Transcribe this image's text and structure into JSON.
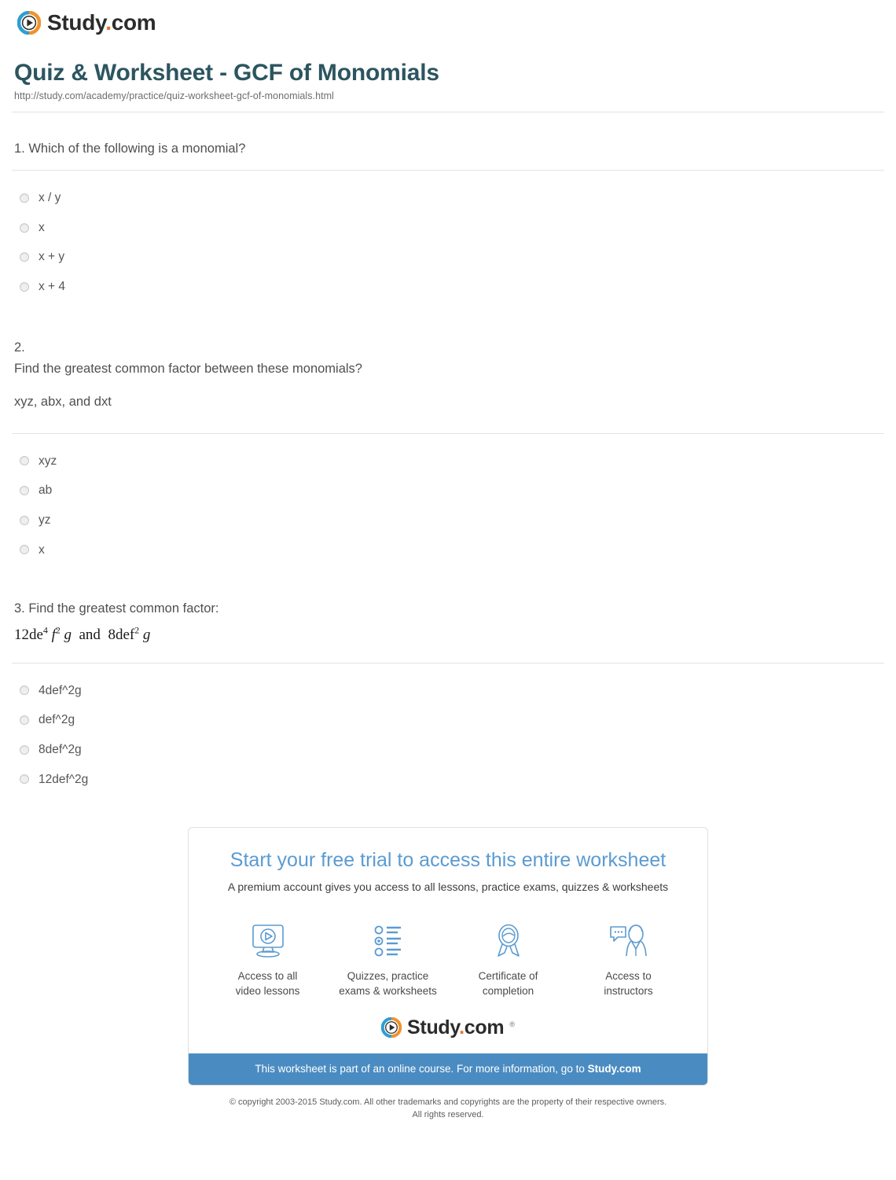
{
  "header": {
    "logo_word_main": "Study",
    "logo_word_dot": ".",
    "logo_word_tld": "com",
    "logo_icon": "play-circle-icon"
  },
  "title": {
    "heading": "Quiz & Worksheet - GCF of Monomials",
    "url": "http://study.com/academy/practice/quiz-worksheet-gcf-of-monomials.html"
  },
  "questions": [
    {
      "prompt": "1. Which of the following is a monomial?",
      "prompt2": "",
      "prompt3": "",
      "math": "",
      "options": [
        {
          "label": "x / y"
        },
        {
          "label": "x"
        },
        {
          "label": "x + y"
        },
        {
          "label": "x + 4"
        }
      ]
    },
    {
      "prompt": "2.",
      "prompt2": "Find the greatest common factor between these monomials?",
      "prompt3": "xyz, abx, and dxt",
      "math": "",
      "options": [
        {
          "label": "xyz"
        },
        {
          "label": "ab"
        },
        {
          "label": "yz"
        },
        {
          "label": "x"
        }
      ]
    },
    {
      "prompt": "3. Find the greatest common factor:",
      "prompt2": "",
      "prompt3": "",
      "math": "12de4 f2 g  and  8def2 g",
      "math_parts": {
        "coef1": "12de",
        "exp1": "4",
        "var_f": "f",
        "exp_f": "2",
        "var_g": "g",
        "conjunction": "and",
        "coef2": "8def",
        "exp2": "2",
        "var_g2": "g"
      },
      "options": [
        {
          "label": "4def^2g"
        },
        {
          "label": "def^2g"
        },
        {
          "label": "8def^2g"
        },
        {
          "label": "12def^2g"
        }
      ]
    }
  ],
  "promo": {
    "headline": "Start your free trial to access this entire worksheet",
    "subtitle": "A premium account gives you access to all lessons, practice exams, quizzes & worksheets",
    "features": [
      {
        "icon": "monitor-play-icon",
        "label": "Access to all\nvideo lessons"
      },
      {
        "icon": "checklist-icon",
        "label": "Quizzes, practice\nexams & worksheets"
      },
      {
        "icon": "award-ribbon-icon",
        "label": "Certificate of\ncompletion"
      },
      {
        "icon": "instructor-chat-icon",
        "label": "Access to\ninstructors"
      }
    ],
    "logo_word_main": "Study",
    "logo_word_dot": ".",
    "logo_word_tld": "com",
    "registered_mark": "®",
    "banner_text": "This worksheet is part of an online course. For more information, go to ",
    "banner_link": "Study.com",
    "banner_color": "#4a8cc2"
  },
  "footer": {
    "copyright_line1": "© copyright 2003-2015 Study.com. All other trademarks and copyrights are the property of their respective owners.",
    "copyright_line2": "All rights reserved."
  },
  "colors": {
    "title": "#2c5560",
    "accent_orange": "#e8742a",
    "accent_blue": "#2f9fd0",
    "promo_blue": "#5b9bd1"
  }
}
